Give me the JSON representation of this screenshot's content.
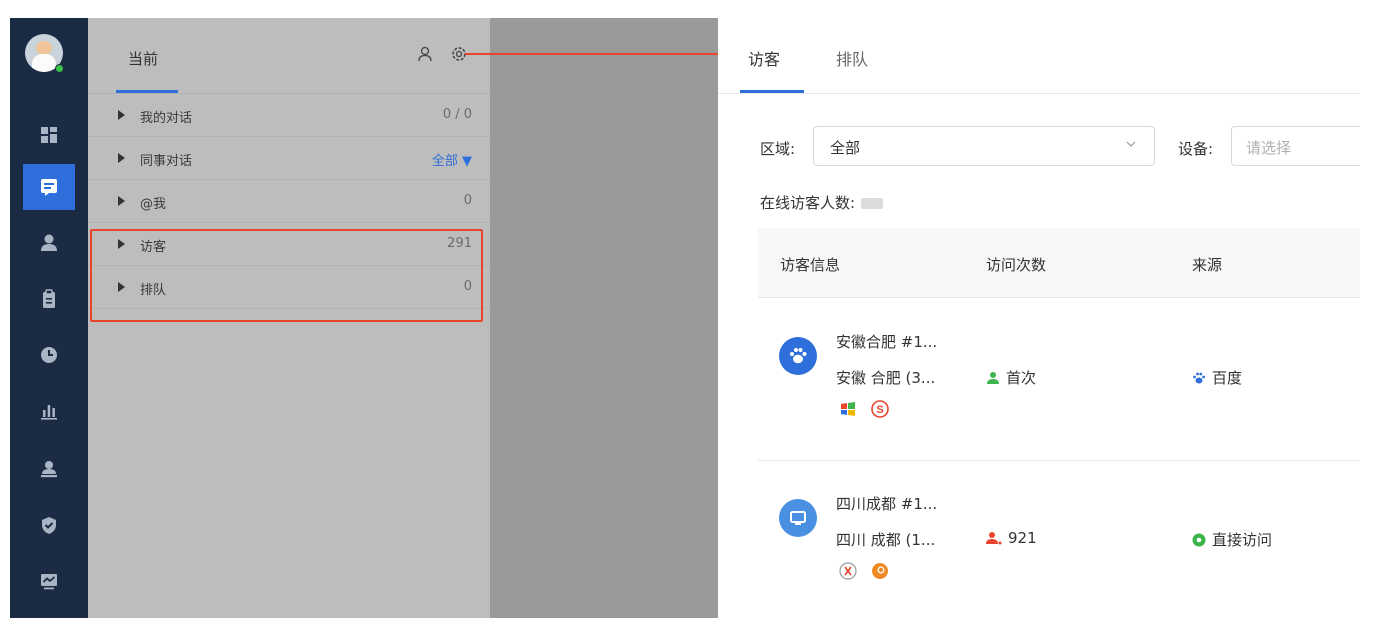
{
  "list_panel": {
    "title": "当前",
    "rows": [
      {
        "label": "我的对话",
        "count": "0 / 0"
      },
      {
        "label": "同事对话",
        "count": "全部 ▼"
      },
      {
        "label": "@我",
        "count": "0"
      },
      {
        "label": "访客",
        "count": "291"
      },
      {
        "label": "排队",
        "count": "0"
      }
    ]
  },
  "detail": {
    "tabs": [
      "访客",
      "排队"
    ],
    "filters": {
      "region_label": "区域:",
      "region_value": "全部",
      "device_label": "设备:",
      "device_placeholder": "请选择"
    },
    "online_label": "在线访客人数:",
    "table": {
      "headers": [
        "访客信息",
        "访问次数",
        "来源"
      ],
      "rows": [
        {
          "name": "安徽合肥 #1...",
          "location": "安徽 合肥 (3...",
          "visits": "首次",
          "source": "百度"
        },
        {
          "name": "四川成都 #1...",
          "location": "四川 成都 (1...",
          "visits": "921",
          "source": "直接访问"
        }
      ]
    }
  },
  "colors": {
    "rail_bg": "#1b2b44",
    "accent": "#2f6fdc",
    "highlight": "#e8452c"
  },
  "icons": {
    "rail": [
      "dashboard-icon",
      "chat-icon",
      "user-icon",
      "clipboard-icon",
      "clock-icon",
      "bar-chart-icon",
      "team-icon",
      "shield-icon",
      "monitor-chart-icon"
    ]
  }
}
